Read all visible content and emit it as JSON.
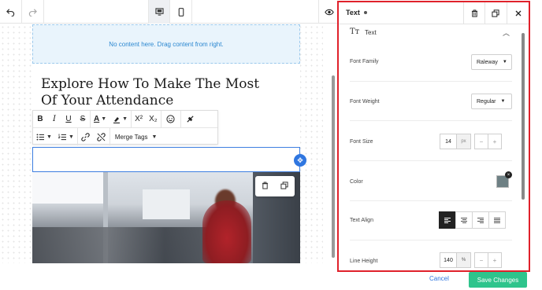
{
  "toolbar": {
    "undo_icon": "undo-icon",
    "redo_icon": "redo-icon",
    "desktop_icon": "desktop-icon",
    "mobile_icon": "mobile-icon",
    "preview_icon": "eye-icon"
  },
  "canvas": {
    "empty_zone_text": "No content here. Drag content from right.",
    "heading_text": "Explore How To Make The Most Of Your Attendance",
    "rte": {
      "bold": "B",
      "italic": "I",
      "underline": "U",
      "strike": "S",
      "font_color": "A",
      "superscript": "X²",
      "subscript": "X₂",
      "merge_tags": "Merge Tags"
    }
  },
  "panel": {
    "title": "Text",
    "section_label": "Text",
    "section_icon": "text-size-icon",
    "font_family_label": "Font Family",
    "font_family_value": "Raleway",
    "font_weight_label": "Font Weight",
    "font_weight_value": "Regular",
    "font_size_label": "Font Size",
    "font_size_value": "14",
    "font_size_unit": "px",
    "color_label": "Color",
    "color_value": "#6e8084",
    "text_align_label": "Text Align",
    "text_align_selected": "left",
    "line_height_label": "Line Height",
    "line_height_value": "140",
    "line_height_unit": "%",
    "minus": "−",
    "plus": "+"
  },
  "footer": {
    "cancel_label": "Cancel",
    "save_label": "Save Changes"
  },
  "colors": {
    "accent_blue": "#2f76e0",
    "save_green": "#2ec48c",
    "panel_border": "#e0212b"
  }
}
